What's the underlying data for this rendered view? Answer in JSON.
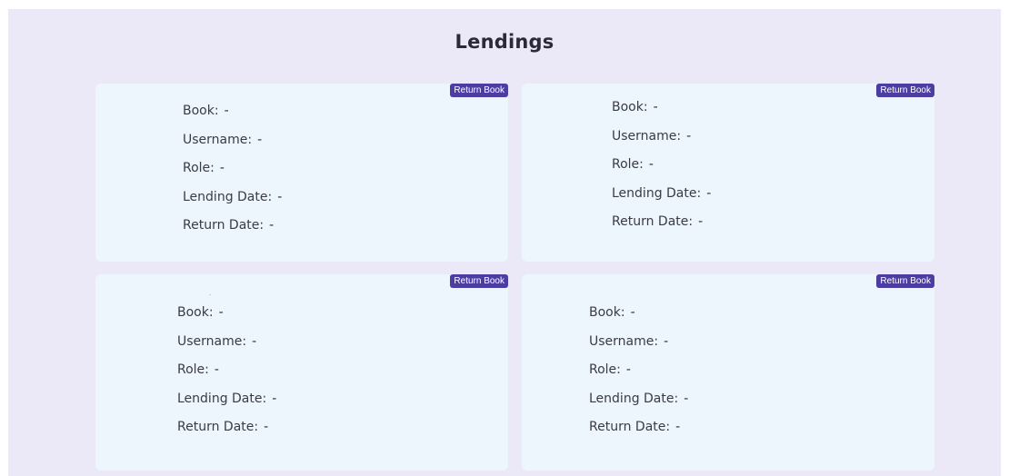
{
  "page": {
    "title": "Lendings"
  },
  "labels": {
    "book": "Book:",
    "username": "Username:",
    "role": "Role:",
    "lending_date": "Lending Date:",
    "return_date": "Return Date:"
  },
  "colors": {
    "background": "#ebe8f7",
    "card": "#eef6fd",
    "button": "#4c3da3"
  },
  "lendings": [
    {
      "button_label": "Return Book",
      "book": "-",
      "username": "-",
      "role": "-",
      "lending_date": "-",
      "return_date": "-"
    },
    {
      "button_label": "Return Book",
      "book": "-",
      "username": "-",
      "role": "-",
      "lending_date": "-",
      "return_date": "-"
    },
    {
      "button_label": "Return Book",
      "book": "-",
      "username": "-",
      "role": "-",
      "lending_date": "-",
      "return_date": "-"
    },
    {
      "button_label": "Return Book",
      "book": "-",
      "username": "-",
      "role": "-",
      "lending_date": "-",
      "return_date": "-"
    }
  ]
}
